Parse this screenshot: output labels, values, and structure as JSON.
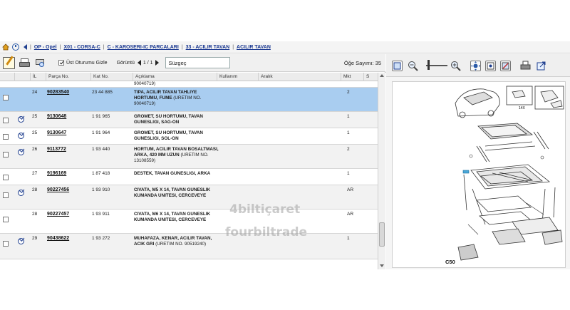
{
  "breadcrumb": {
    "items": [
      "OP - Opel",
      "X01 - CORSA-C",
      "C - KAROSERI-IC PARCALARI",
      "33 - ACILIR TAVAN",
      "ACILIR TAVAN"
    ],
    "separator": "|"
  },
  "toolbar": {
    "hide_top_label": "Üst Oturumu Gizle",
    "view_label": "Görüntü",
    "page": "1 / 1",
    "filter_value": "Süzgeç",
    "item_count": "Öğe Sayımı: 35"
  },
  "table": {
    "headers": [
      "İL",
      "Parça No.",
      "Kat No.",
      "Açıklama",
      "Kullanım",
      "Aralık",
      "Mkt",
      "S"
    ],
    "clipped_top_text": "90040719)",
    "rows": [
      {
        "il": "24",
        "part_no": "90283540",
        "cat_no": "23 44 885",
        "desc_bold": "TIPA, ACILIR TAVAN TAHLIYE HORTUMU, FUME",
        "desc_note": "(URETIM NO. 90040719)",
        "qty": "2",
        "selected": true,
        "icon": false
      },
      {
        "il": "25",
        "part_no": "9130648",
        "cat_no": "1 91 965",
        "desc_bold": "GROMET, SU HORTUMU, TAVAN GUNESLIGI, SAG-ON",
        "desc_note": "",
        "qty": "1",
        "selected": false,
        "icon": true
      },
      {
        "il": "25",
        "part_no": "9130647",
        "cat_no": "1 91 964",
        "desc_bold": "GROMET, SU HORTUMU, TAVAN GUNESLIGI, SOL-ON",
        "desc_note": "",
        "qty": "1",
        "selected": false,
        "icon": true
      },
      {
        "il": "26",
        "part_no": "9113772",
        "cat_no": "1 93 440",
        "desc_bold": "HORTUM, ACILIR TAVAN BOSALTMASI, ARKA, 420 MM UZUN",
        "desc_note": "(URETIM NO. 13108559)",
        "qty": "2",
        "selected": false,
        "icon": true
      },
      {
        "il": "27",
        "part_no": "9196169",
        "cat_no": "1 87 418",
        "desc_bold": "DESTEK, TAVAN GUNESLIGI, ARKA",
        "desc_note": "",
        "qty": "1",
        "selected": false,
        "icon": false
      },
      {
        "il": "28",
        "part_no": "90227456",
        "cat_no": "1 93 910",
        "desc_bold": "CIVATA, M5 X 14, TAVAN GUNESLIK KUMANDA UNITESI, CERCEVEYE",
        "desc_note": "",
        "qty": "AR",
        "selected": false,
        "icon": true
      },
      {
        "il": "28",
        "part_no": "90227457",
        "cat_no": "1 93 911",
        "desc_bold": "CIVATA, M6 X 14, TAVAN GUNESLIK KUMANDA UNITESI, CERCEVEYE",
        "desc_note": "",
        "qty": "AR",
        "selected": false,
        "icon": false
      },
      {
        "il": "29",
        "part_no": "90438622",
        "cat_no": "1 93 272",
        "desc_bold": "MUHAFAZA, KENAR, ACILIR TAVAN, ACIK GRI",
        "desc_note": "(URETIM NO. 90519240)",
        "qty": "1",
        "selected": false,
        "icon": true
      }
    ]
  },
  "diagram": {
    "code": "C50",
    "callout": "14X"
  },
  "watermark": [
    "4biltiçaret",
    "fourbiltrade"
  ],
  "colors": {
    "selected_row": "#a9cdf0",
    "link": "#17358f"
  }
}
